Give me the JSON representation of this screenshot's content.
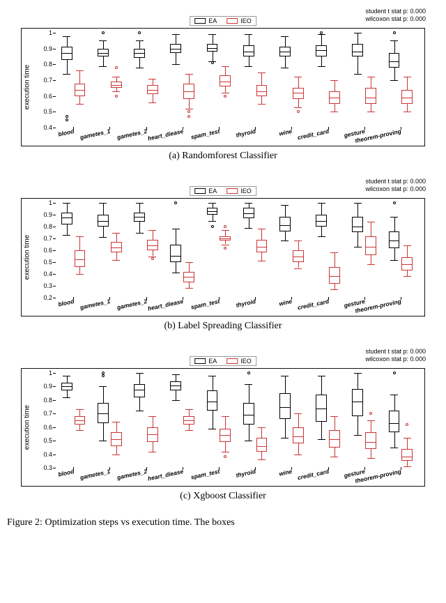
{
  "stats_lines": [
    "student t stat p: 0.000",
    "wilcoxon stat p: 0.000"
  ],
  "legend": {
    "ea": "EA",
    "ieo": "IEO"
  },
  "ylabel": "execution time",
  "categories": [
    "blood",
    "gametes_1",
    "gametes_2",
    "heart_diease",
    "spam_test",
    "thyroid",
    "wine",
    "credit_card",
    "gesture",
    "theorem-proving"
  ],
  "figure_caption_prefix": "Figure 2:",
  "figure_caption_rest": "Optimization steps vs execution time. The boxes",
  "chart_data": [
    {
      "type": "box",
      "caption": "(a) Randomforest Classifier",
      "ylim": [
        0.4,
        1.0
      ],
      "yticks": [
        0.4,
        0.5,
        0.6,
        0.7,
        0.8,
        0.9,
        1.0
      ],
      "series": [
        {
          "name": "EA",
          "color": "#000",
          "boxes": [
            {
              "low": 0.74,
              "q1": 0.83,
              "med": 0.87,
              "q3": 0.91,
              "high": 0.98,
              "out": [
                0.45,
                0.47
              ]
            },
            {
              "low": 0.79,
              "q1": 0.85,
              "med": 0.87,
              "q3": 0.9,
              "high": 0.95,
              "out": [
                1.0
              ]
            },
            {
              "low": 0.78,
              "q1": 0.84,
              "med": 0.87,
              "q3": 0.9,
              "high": 0.95,
              "out": [
                1.0
              ]
            },
            {
              "low": 0.8,
              "q1": 0.87,
              "med": 0.9,
              "q3": 0.93,
              "high": 0.99,
              "out": []
            },
            {
              "low": 0.82,
              "q1": 0.88,
              "med": 0.9,
              "q3": 0.93,
              "high": 0.99,
              "out": [
                0.81
              ]
            },
            {
              "low": 0.79,
              "q1": 0.85,
              "med": 0.88,
              "q3": 0.92,
              "high": 0.99,
              "out": []
            },
            {
              "low": 0.78,
              "q1": 0.85,
              "med": 0.88,
              "q3": 0.91,
              "high": 0.98,
              "out": []
            },
            {
              "low": 0.79,
              "q1": 0.85,
              "med": 0.89,
              "q3": 0.92,
              "high": 0.99,
              "out": [
                1.0
              ]
            },
            {
              "low": 0.74,
              "q1": 0.85,
              "med": 0.88,
              "q3": 0.93,
              "high": 1.0,
              "out": []
            },
            {
              "low": 0.7,
              "q1": 0.78,
              "med": 0.82,
              "q3": 0.87,
              "high": 0.95,
              "out": [
                1.0
              ]
            }
          ]
        },
        {
          "name": "IEO",
          "color": "#c33",
          "boxes": [
            {
              "low": 0.55,
              "q1": 0.6,
              "med": 0.64,
              "q3": 0.68,
              "high": 0.76,
              "out": []
            },
            {
              "low": 0.63,
              "q1": 0.65,
              "med": 0.67,
              "q3": 0.69,
              "high": 0.72,
              "out": [
                0.6,
                0.78
              ]
            },
            {
              "low": 0.56,
              "q1": 0.61,
              "med": 0.64,
              "q3": 0.67,
              "high": 0.71,
              "out": []
            },
            {
              "low": 0.52,
              "q1": 0.58,
              "med": 0.63,
              "q3": 0.68,
              "high": 0.74,
              "out": [
                0.47,
                0.5
              ]
            },
            {
              "low": 0.62,
              "q1": 0.66,
              "med": 0.69,
              "q3": 0.73,
              "high": 0.79,
              "out": [
                0.6
              ]
            },
            {
              "low": 0.55,
              "q1": 0.6,
              "med": 0.63,
              "q3": 0.67,
              "high": 0.75,
              "out": []
            },
            {
              "low": 0.53,
              "q1": 0.58,
              "med": 0.62,
              "q3": 0.65,
              "high": 0.72,
              "out": [
                0.5
              ]
            },
            {
              "low": 0.5,
              "q1": 0.55,
              "med": 0.59,
              "q3": 0.63,
              "high": 0.7,
              "out": []
            },
            {
              "low": 0.5,
              "q1": 0.55,
              "med": 0.59,
              "q3": 0.65,
              "high": 0.72,
              "out": []
            },
            {
              "low": 0.5,
              "q1": 0.55,
              "med": 0.59,
              "q3": 0.64,
              "high": 0.72,
              "out": []
            }
          ]
        }
      ]
    },
    {
      "type": "box",
      "caption": "(b) Label Spreading Classifier",
      "ylim": [
        0.2,
        1.0
      ],
      "yticks": [
        0.2,
        0.3,
        0.4,
        0.5,
        0.6,
        0.7,
        0.8,
        0.9,
        1.0
      ],
      "series": [
        {
          "name": "EA",
          "color": "#000",
          "boxes": [
            {
              "low": 0.73,
              "q1": 0.82,
              "med": 0.88,
              "q3": 0.92,
              "high": 1.0,
              "out": []
            },
            {
              "low": 0.71,
              "q1": 0.8,
              "med": 0.85,
              "q3": 0.9,
              "high": 1.0,
              "out": []
            },
            {
              "low": 0.75,
              "q1": 0.84,
              "med": 0.88,
              "q3": 0.92,
              "high": 1.0,
              "out": []
            },
            {
              "low": 0.41,
              "q1": 0.5,
              "med": 0.55,
              "q3": 0.65,
              "high": 0.78,
              "out": [
                1.0
              ]
            },
            {
              "low": 0.85,
              "q1": 0.9,
              "med": 0.93,
              "q3": 0.96,
              "high": 1.0,
              "out": [
                0.8
              ]
            },
            {
              "low": 0.79,
              "q1": 0.87,
              "med": 0.91,
              "q3": 0.96,
              "high": 1.0,
              "out": []
            },
            {
              "low": 0.68,
              "q1": 0.76,
              "med": 0.81,
              "q3": 0.88,
              "high": 0.98,
              "out": []
            },
            {
              "low": 0.72,
              "q1": 0.8,
              "med": 0.85,
              "q3": 0.9,
              "high": 1.0,
              "out": []
            },
            {
              "low": 0.63,
              "q1": 0.75,
              "med": 0.8,
              "q3": 0.88,
              "high": 1.0,
              "out": []
            },
            {
              "low": 0.52,
              "q1": 0.62,
              "med": 0.68,
              "q3": 0.76,
              "high": 0.88,
              "out": [
                1.0
              ]
            }
          ]
        },
        {
          "name": "IEO",
          "color": "#c33",
          "boxes": [
            {
              "low": 0.4,
              "q1": 0.46,
              "med": 0.52,
              "q3": 0.6,
              "high": 0.72,
              "out": []
            },
            {
              "low": 0.52,
              "q1": 0.58,
              "med": 0.62,
              "q3": 0.67,
              "high": 0.75,
              "out": []
            },
            {
              "low": 0.55,
              "q1": 0.6,
              "med": 0.64,
              "q3": 0.69,
              "high": 0.77,
              "out": [
                0.53
              ]
            },
            {
              "low": 0.28,
              "q1": 0.33,
              "med": 0.38,
              "q3": 0.42,
              "high": 0.5,
              "out": []
            },
            {
              "low": 0.65,
              "q1": 0.68,
              "med": 0.7,
              "q3": 0.72,
              "high": 0.77,
              "out": [
                0.62,
                0.8
              ]
            },
            {
              "low": 0.51,
              "q1": 0.58,
              "med": 0.63,
              "q3": 0.69,
              "high": 0.78,
              "out": []
            },
            {
              "low": 0.45,
              "q1": 0.5,
              "med": 0.55,
              "q3": 0.6,
              "high": 0.68,
              "out": []
            },
            {
              "low": 0.27,
              "q1": 0.32,
              "med": 0.38,
              "q3": 0.46,
              "high": 0.58,
              "out": []
            },
            {
              "low": 0.48,
              "q1": 0.56,
              "med": 0.63,
              "q3": 0.72,
              "high": 0.84,
              "out": []
            },
            {
              "low": 0.38,
              "q1": 0.43,
              "med": 0.48,
              "q3": 0.54,
              "high": 0.64,
              "out": []
            }
          ]
        }
      ]
    },
    {
      "type": "box",
      "caption": "(c) Xgboost Classifier",
      "ylim": [
        0.3,
        1.0
      ],
      "yticks": [
        0.3,
        0.4,
        0.5,
        0.6,
        0.7,
        0.8,
        0.9,
        1.0
      ],
      "series": [
        {
          "name": "EA",
          "color": "#000",
          "boxes": [
            {
              "low": 0.82,
              "q1": 0.87,
              "med": 0.9,
              "q3": 0.93,
              "high": 0.98,
              "out": []
            },
            {
              "low": 0.5,
              "q1": 0.63,
              "med": 0.7,
              "q3": 0.78,
              "high": 0.9,
              "out": [
                1.0,
                0.98
              ]
            },
            {
              "low": 0.72,
              "q1": 0.82,
              "med": 0.88,
              "q3": 0.92,
              "high": 1.0,
              "out": []
            },
            {
              "low": 0.8,
              "q1": 0.87,
              "med": 0.91,
              "q3": 0.94,
              "high": 0.99,
              "out": []
            },
            {
              "low": 0.59,
              "q1": 0.72,
              "med": 0.79,
              "q3": 0.87,
              "high": 0.98,
              "out": []
            },
            {
              "low": 0.5,
              "q1": 0.62,
              "med": 0.69,
              "q3": 0.78,
              "high": 0.92,
              "out": [
                1.0
              ]
            },
            {
              "low": 0.52,
              "q1": 0.66,
              "med": 0.75,
              "q3": 0.85,
              "high": 0.98,
              "out": []
            },
            {
              "low": 0.51,
              "q1": 0.64,
              "med": 0.74,
              "q3": 0.84,
              "high": 0.98,
              "out": []
            },
            {
              "low": 0.54,
              "q1": 0.68,
              "med": 0.79,
              "q3": 0.88,
              "high": 1.0,
              "out": []
            },
            {
              "low": 0.45,
              "q1": 0.56,
              "med": 0.63,
              "q3": 0.72,
              "high": 0.84,
              "out": [
                1.0
              ]
            }
          ]
        },
        {
          "name": "IEO",
          "color": "#c33",
          "boxes": [
            {
              "low": 0.58,
              "q1": 0.62,
              "med": 0.65,
              "q3": 0.68,
              "high": 0.73,
              "out": []
            },
            {
              "low": 0.4,
              "q1": 0.46,
              "med": 0.51,
              "q3": 0.56,
              "high": 0.64,
              "out": []
            },
            {
              "low": 0.42,
              "q1": 0.49,
              "med": 0.55,
              "q3": 0.6,
              "high": 0.68,
              "out": []
            },
            {
              "low": 0.58,
              "q1": 0.62,
              "med": 0.65,
              "q3": 0.68,
              "high": 0.73,
              "out": []
            },
            {
              "low": 0.42,
              "q1": 0.49,
              "med": 0.54,
              "q3": 0.59,
              "high": 0.68,
              "out": [
                0.38
              ]
            },
            {
              "low": 0.36,
              "q1": 0.42,
              "med": 0.46,
              "q3": 0.52,
              "high": 0.6,
              "out": []
            },
            {
              "low": 0.4,
              "q1": 0.48,
              "med": 0.53,
              "q3": 0.6,
              "high": 0.7,
              "out": []
            },
            {
              "low": 0.38,
              "q1": 0.45,
              "med": 0.51,
              "q3": 0.58,
              "high": 0.68,
              "out": []
            },
            {
              "low": 0.37,
              "q1": 0.44,
              "med": 0.49,
              "q3": 0.56,
              "high": 0.65,
              "out": [
                0.7
              ]
            },
            {
              "low": 0.31,
              "q1": 0.35,
              "med": 0.38,
              "q3": 0.44,
              "high": 0.52,
              "out": [
                0.62
              ]
            }
          ]
        }
      ]
    }
  ]
}
